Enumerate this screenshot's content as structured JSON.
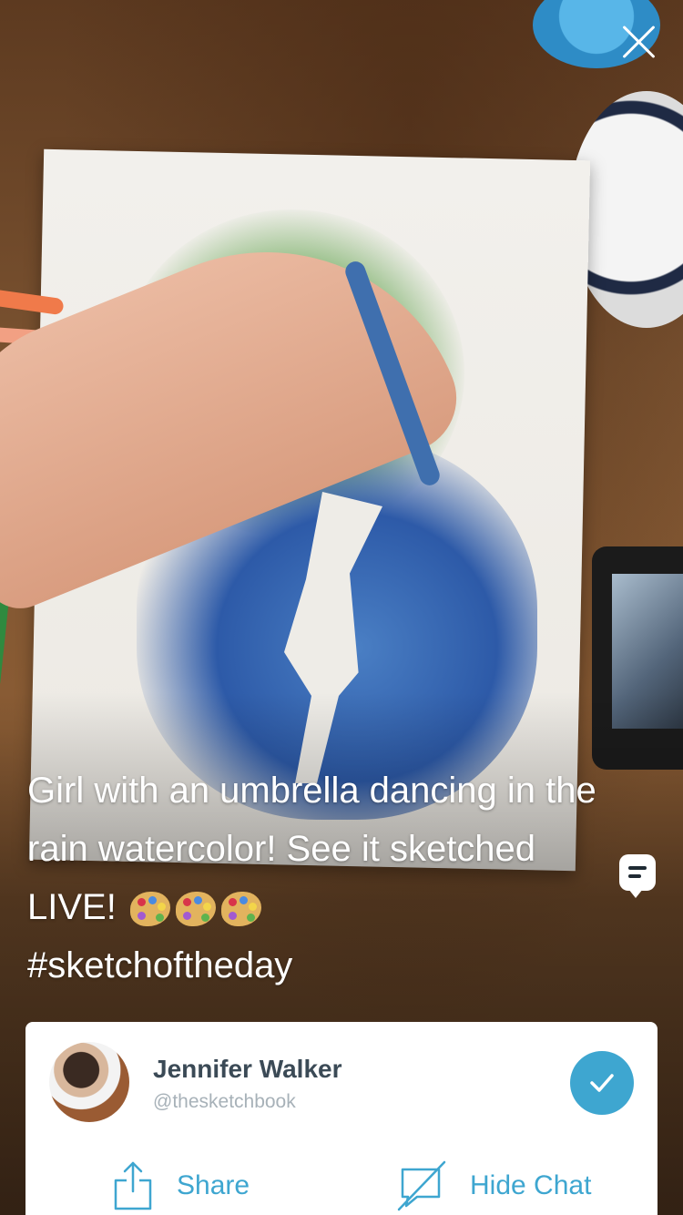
{
  "caption": {
    "text": "Girl with an umbrella dancing in the rain watercolor! See it sketched LIVE!",
    "hashtag": "#sketchoftheday",
    "emoji_name": "artist-palette-emoji",
    "emoji_count": 3
  },
  "broadcaster": {
    "name": "Jennifer Walker",
    "handle": "@thesketchbook"
  },
  "actions": {
    "share_label": "Share",
    "hide_chat_label": "Hide Chat"
  },
  "colors": {
    "accent": "#3ea6d0",
    "name_text": "#3b4a56",
    "handle_text": "#a7b1b8"
  }
}
